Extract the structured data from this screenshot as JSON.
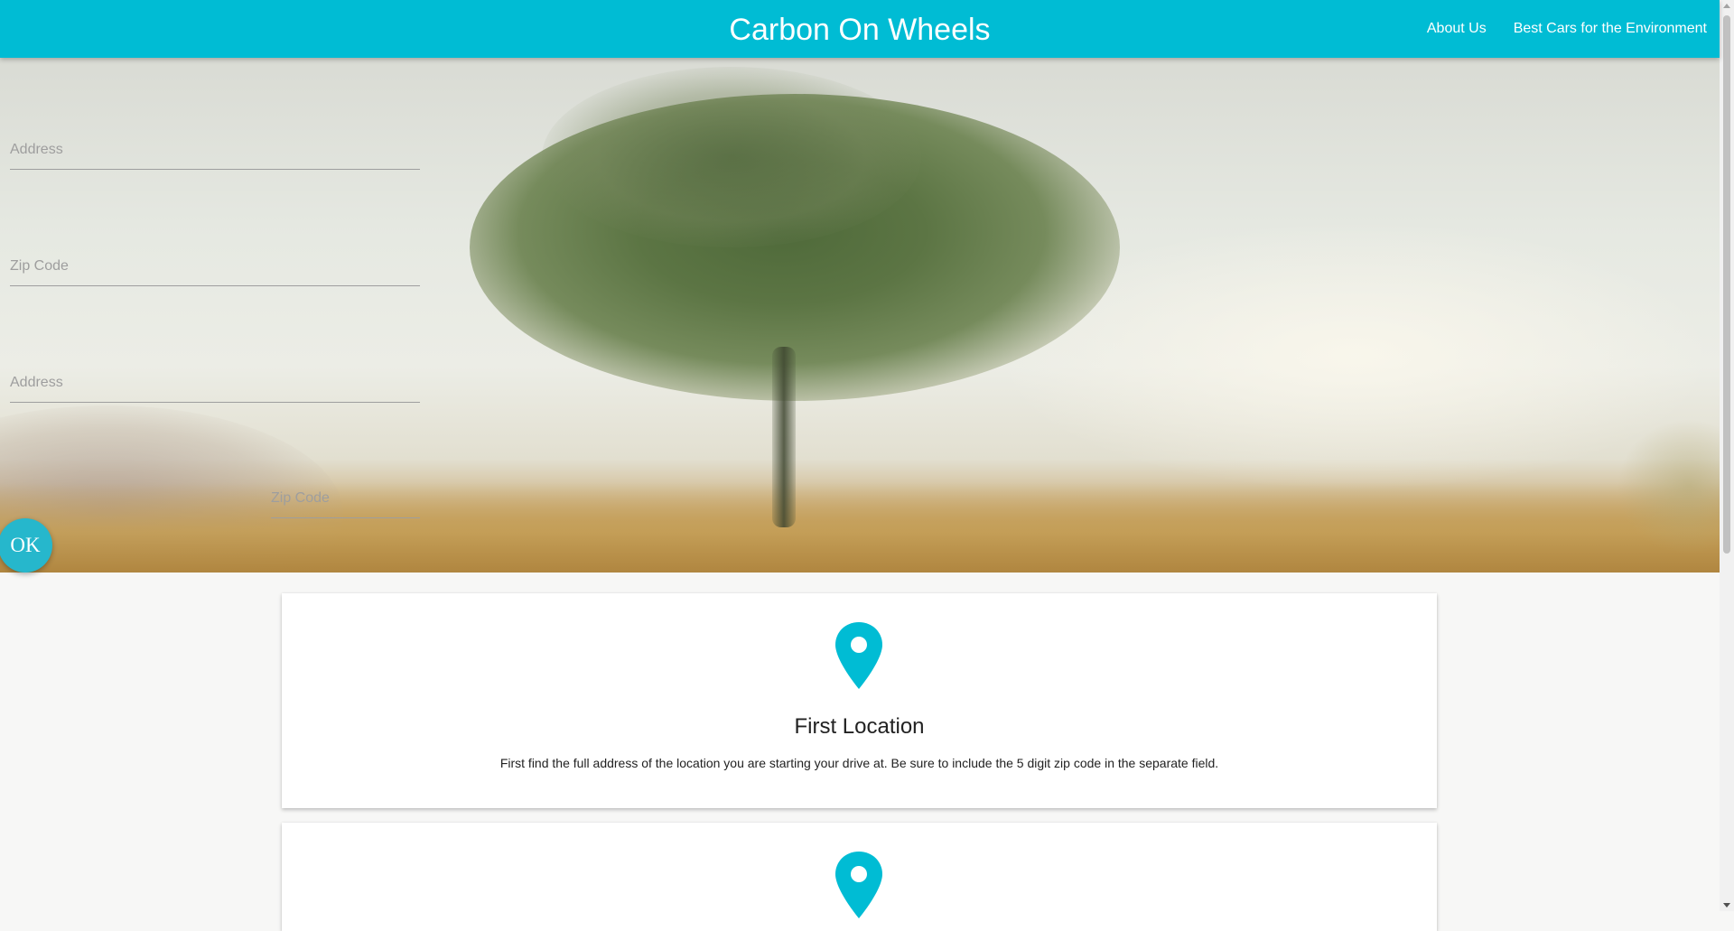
{
  "navbar": {
    "brand": "Carbon On Wheels",
    "links": [
      {
        "label": "About Us"
      },
      {
        "label": "Best Cars for the Environment"
      }
    ]
  },
  "form": {
    "start_address": {
      "placeholder": "Address",
      "value": ""
    },
    "start_zip": {
      "placeholder": "Zip Code",
      "value": ""
    },
    "dest_address": {
      "placeholder": "Address",
      "value": ""
    },
    "dest_zip": {
      "placeholder": "Zip Code",
      "value": ""
    },
    "submit_label": "OK"
  },
  "cards": [
    {
      "icon": "location-pin-icon",
      "title": "First Location",
      "text": "First find the full address of the location you are starting your drive at. Be sure to include the 5 digit zip code in the separate field."
    },
    {
      "icon": "location-pin-icon"
    }
  ],
  "colors": {
    "primary": "#00bcd4",
    "button": "#26b7cc",
    "page_background": "#f7f7f6"
  }
}
